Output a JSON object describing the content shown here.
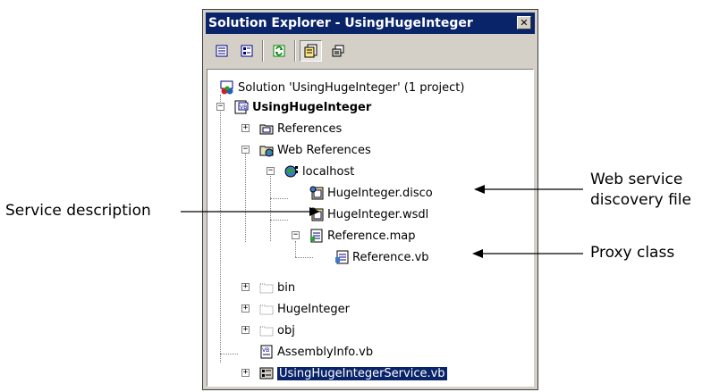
{
  "window": {
    "title": "Solution Explorer - UsingHugeInteger",
    "close_glyph": "✕"
  },
  "toolbar": {
    "buttons": [
      "properties-icon",
      "show-all-files-icon",
      "refresh-icon",
      "view-code-icon",
      "view-designer-icon"
    ]
  },
  "tree": {
    "solution": "Solution 'UsingHugeInteger' (1 project)",
    "project": "UsingHugeInteger",
    "references": "References",
    "web_references": "Web References",
    "localhost": "localhost",
    "disco": "HugeInteger.disco",
    "wsdl": "HugeInteger.wsdl",
    "refmap": "Reference.map",
    "refvb": "Reference.vb",
    "bin": "bin",
    "hugeinteger_folder": "HugeInteger",
    "obj": "obj",
    "assemblyinfo": "AssemblyInfo.vb",
    "service": "UsingHugeIntegerService.vb"
  },
  "callouts": {
    "service_description": "Service description",
    "web_service_line1": "Web service",
    "web_service_line2": "discovery file",
    "proxy_class": "Proxy class"
  }
}
